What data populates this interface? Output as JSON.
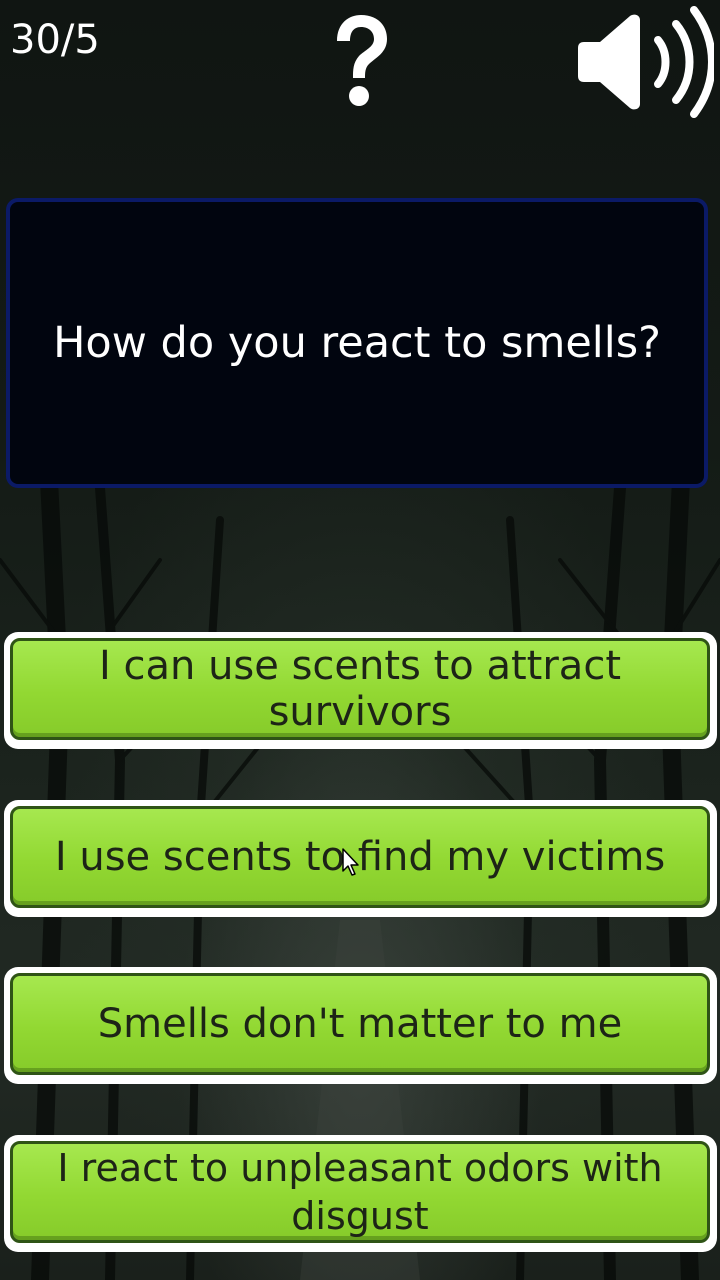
{
  "header": {
    "counter": "30/5",
    "help_icon": "question-mark-icon",
    "sound_icon": "speaker-volume-icon"
  },
  "question": {
    "text": "How do you react to smells?"
  },
  "answers": [
    {
      "label": "I can use scents to attract survivors"
    },
    {
      "label": "I use scents to find my victims"
    },
    {
      "label": "Smells don't matter to me"
    },
    {
      "label": "I react to unpleasant odors with disgust"
    }
  ],
  "colors": {
    "answer_green": "#92d832",
    "answer_border": "#2f5416",
    "question_bg": "#01050f",
    "question_border": "#0b1a66",
    "text_white": "#ffffff"
  }
}
